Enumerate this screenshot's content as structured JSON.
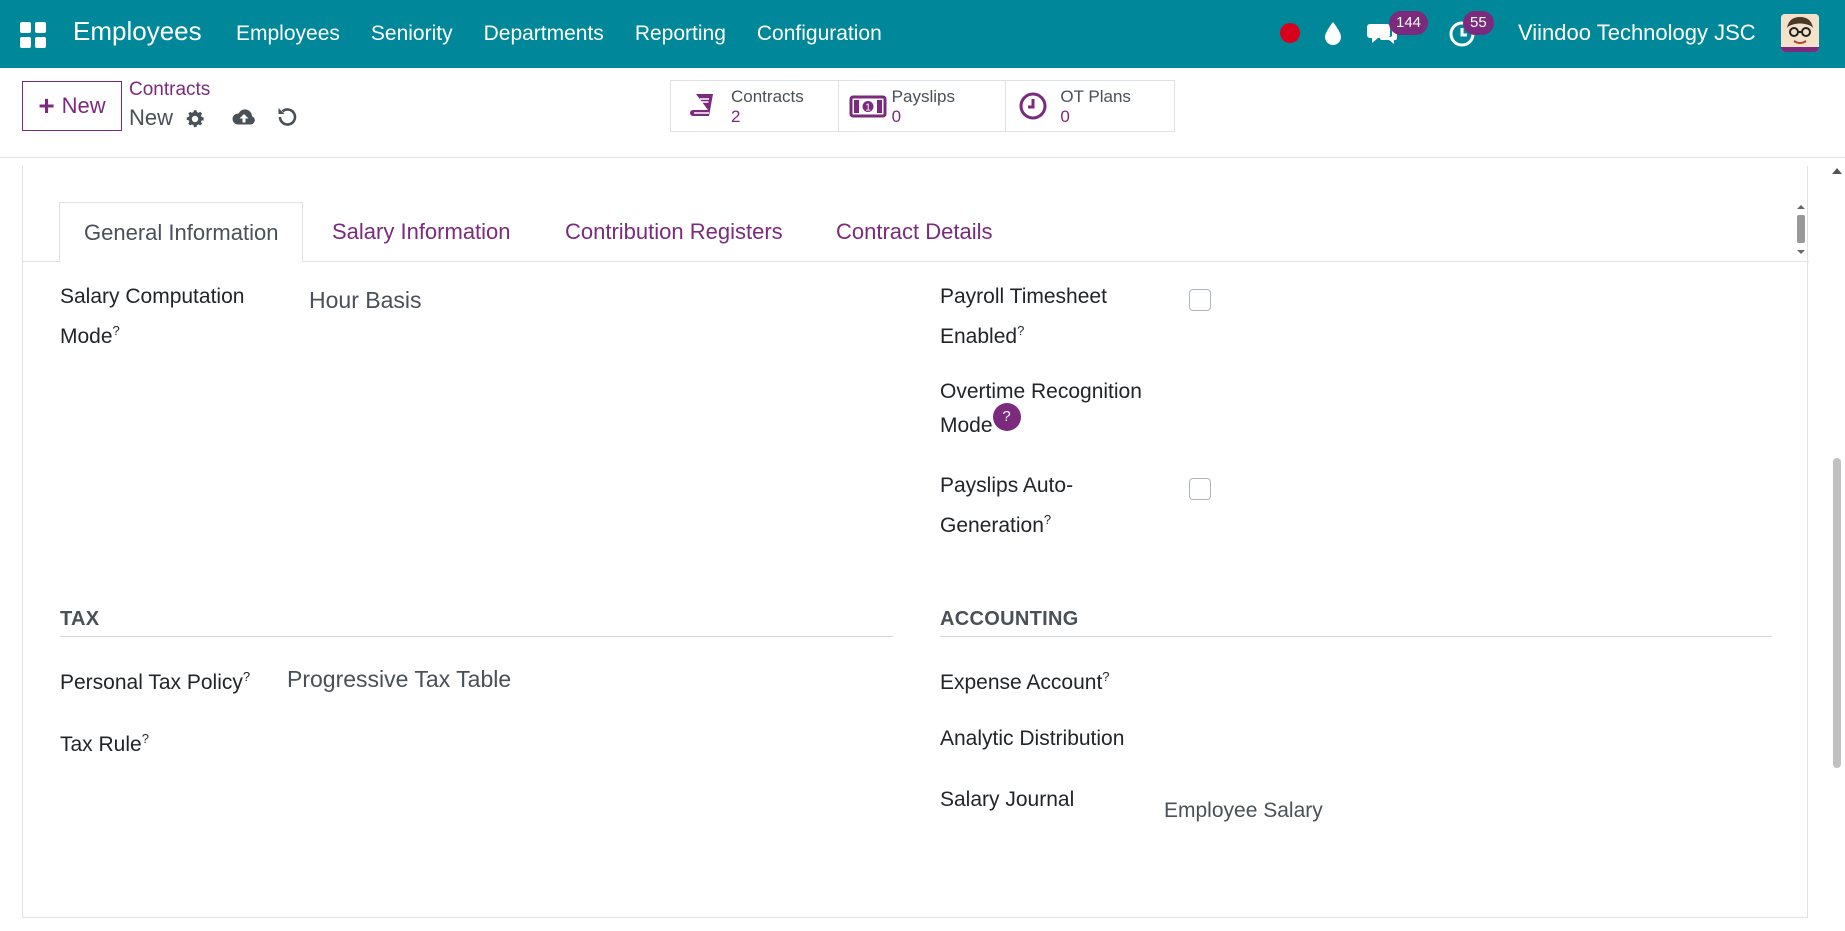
{
  "navbar": {
    "app_name": "Employees",
    "menu": [
      "Employees",
      "Seniority",
      "Departments",
      "Reporting",
      "Configuration"
    ],
    "chat_count": "144",
    "activity_count": "55",
    "company": "Viindoo Technology JSC",
    "colors": {
      "bar": "#00889a",
      "badge": "#7b2a7e",
      "recording": "#d9001b"
    },
    "icons": [
      "apps-grid-icon",
      "recording-dot-icon",
      "drop-icon",
      "chat-icon",
      "activity-clock-icon",
      "avatar"
    ]
  },
  "control_panel": {
    "new_button": "New",
    "breadcrumb_parent": "Contracts",
    "breadcrumb_current": "New",
    "smart_buttons": [
      {
        "label": "Contracts",
        "value": "2",
        "icon": "book-icon"
      },
      {
        "label": "Payslips",
        "value": "0",
        "icon": "money-icon"
      },
      {
        "label": "OT Plans",
        "value": "0",
        "icon": "clock-icon"
      }
    ]
  },
  "tabs": [
    {
      "label": "General Information",
      "active": true
    },
    {
      "label": "Salary Information",
      "active": false
    },
    {
      "label": "Contribution Registers",
      "active": false
    },
    {
      "label": "Contract Details",
      "active": false
    }
  ],
  "form": {
    "salary_mode_label_1": "Salary Computation",
    "salary_mode_label_2": "Mode",
    "salary_mode_value": "Hour Basis",
    "payroll_ts_label_1": "Payroll Timesheet",
    "payroll_ts_label_2": "Enabled",
    "payroll_ts_checked": false,
    "ot_label_1": "Overtime Recognition",
    "ot_label_2": "Mode",
    "payslip_auto_label_1": "Payslips Auto-",
    "payslip_auto_label_2": "Generation",
    "payslip_auto_checked": false,
    "tax_title": "TAX",
    "tax_policy_label": "Personal Tax Policy",
    "tax_policy_value": "Progressive Tax Table",
    "tax_rule_label": "Tax Rule",
    "accounting_title": "ACCOUNTING",
    "expense_account_label": "Expense Account",
    "analytic_label": "Analytic Distribution",
    "salary_journal_label": "Salary Journal",
    "salary_journal_value": "Employee Salary",
    "help_marker": "?"
  }
}
